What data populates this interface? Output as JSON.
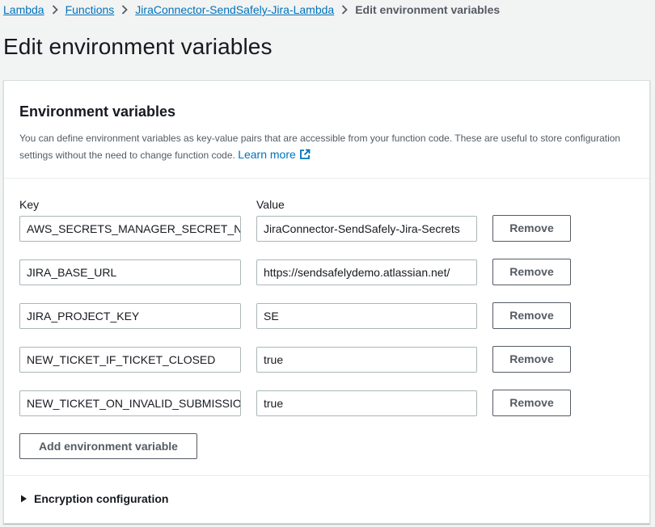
{
  "breadcrumb": {
    "items": [
      "Lambda",
      "Functions",
      "JiraConnector-SendSafely-Jira-Lambda"
    ],
    "current": "Edit environment variables"
  },
  "page": {
    "title": "Edit environment variables"
  },
  "panel": {
    "title": "Environment variables",
    "description": "You can define environment variables as key-value pairs that are accessible from your function code. These are useful to store configuration settings without the need to change function code.",
    "learn_more": "Learn more",
    "key_header": "Key",
    "value_header": "Value",
    "remove_label": "Remove",
    "add_label": "Add environment variable",
    "variables": [
      {
        "key": "AWS_SECRETS_MANAGER_SECRET_NAM",
        "value": "JiraConnector-SendSafely-Jira-Secrets"
      },
      {
        "key": "JIRA_BASE_URL",
        "value": "https://sendsafelydemo.atlassian.net/"
      },
      {
        "key": "JIRA_PROJECT_KEY",
        "value": "SE"
      },
      {
        "key": "NEW_TICKET_IF_TICKET_CLOSED",
        "value": "true"
      },
      {
        "key": "NEW_TICKET_ON_INVALID_SUBMISSION",
        "value": "true"
      }
    ],
    "encryption_label": "Encryption configuration"
  },
  "icons": {
    "separator": "chevron-right-icon",
    "external": "external-link-icon",
    "expander": "caret-right-icon"
  },
  "colors": {
    "link": "#0073bb",
    "text": "#16191f",
    "secondary_text": "#545b64",
    "background": "#f2f3f3",
    "border": "#aab7b8"
  }
}
